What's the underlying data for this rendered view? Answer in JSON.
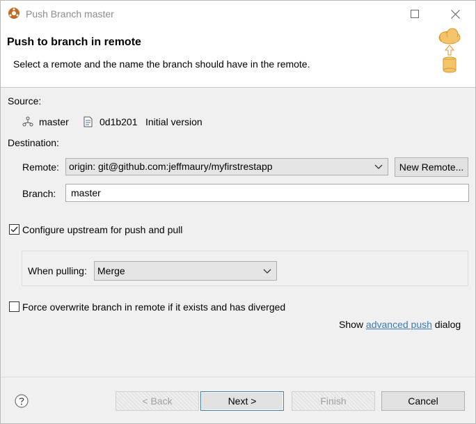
{
  "window": {
    "title": "Push Branch master",
    "controls": {
      "maximize": "maximize-icon",
      "close": "close-icon"
    }
  },
  "header": {
    "title": "Push to branch in remote",
    "description": "Select a remote and the name the branch should have in the remote."
  },
  "source": {
    "label": "Source:",
    "branch": "master",
    "commit_id": "0d1b201",
    "commit_message": "Initial version"
  },
  "destination": {
    "label": "Destination:",
    "remote_label": "Remote:",
    "remote_value": "origin: git@github.com:jeffmaury/myfirstrestapp",
    "new_remote_button": "New Remote...",
    "branch_label": "Branch:",
    "branch_value": "master"
  },
  "upstream": {
    "checkbox_label": "Configure upstream for push and pull",
    "checked": true,
    "when_pulling_label": "When pulling:",
    "when_pulling_value": "Merge"
  },
  "force": {
    "checkbox_label": "Force overwrite branch in remote if it exists and has diverged",
    "checked": false
  },
  "advanced": {
    "prefix": "Show ",
    "link_text": "advanced push",
    "suffix": " dialog"
  },
  "footer": {
    "back": "< Back",
    "next": "Next >",
    "finish": "Finish",
    "cancel": "Cancel"
  },
  "colors": {
    "accent": "#3c7fb1",
    "link": "#3c7bb8",
    "disabled_text": "#a0a0a0"
  }
}
